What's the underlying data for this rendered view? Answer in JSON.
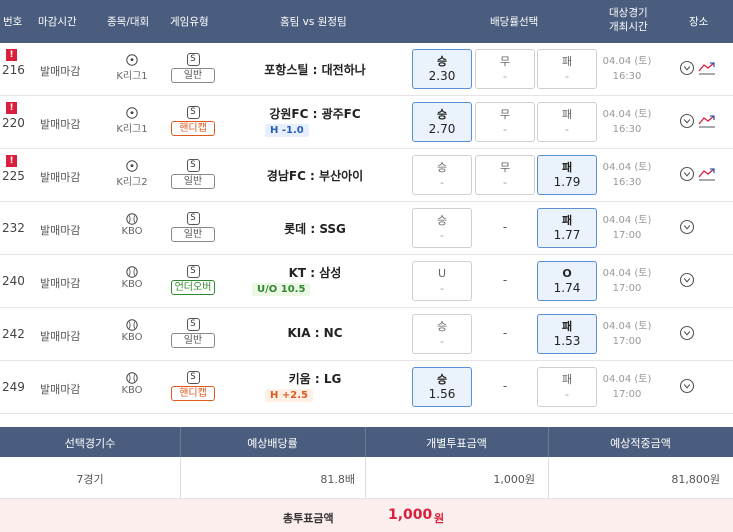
{
  "header": {
    "no": "번호",
    "close": "마감시간",
    "league": "종목/대회",
    "type": "게임유형",
    "match": "홈팀 vs 원정팀",
    "odds": "배당률선택",
    "time": "대상경기\n개최시간",
    "place": "장소"
  },
  "rows": [
    {
      "alert": "!",
      "no": "216",
      "close": "발매마감",
      "league": "K리그1",
      "sport": "soccer",
      "type_s": "S",
      "type": "일반",
      "match": "포항스틸 : 대전하나",
      "note": "",
      "win_label": "승",
      "win": "2.30",
      "draw_label": "무",
      "draw": "-",
      "lose_label": "패",
      "lose": "-",
      "date": "04.04 (토)",
      "time": "16:30"
    },
    {
      "alert": "!",
      "no": "220",
      "close": "발매마감",
      "league": "K리그1",
      "sport": "soccer",
      "type_s": "S",
      "type": "핸디캡",
      "match": "강원FC : 광주FC",
      "note": "H -1.0",
      "win_label": "승",
      "win": "2.70",
      "draw_label": "무",
      "draw": "-",
      "lose_label": "패",
      "lose": "-",
      "date": "04.04 (토)",
      "time": "16:30"
    },
    {
      "alert": "!",
      "no": "225",
      "close": "발매마감",
      "league": "K리그2",
      "sport": "soccer",
      "type_s": "S",
      "type": "일반",
      "match": "경남FC : 부산아이",
      "note": "",
      "win_label": "승",
      "win": "-",
      "draw_label": "무",
      "draw": "-",
      "lose_label": "패",
      "lose": "1.79",
      "date": "04.04 (토)",
      "time": "16:30"
    },
    {
      "alert": "",
      "no": "232",
      "close": "발매마감",
      "league": "KBO",
      "sport": "baseball",
      "type_s": "S",
      "type": "일반",
      "match": "롯데 : SSG",
      "note": "",
      "win_label": "승",
      "win": "-",
      "draw": "-",
      "lose_label": "패",
      "lose": "1.77",
      "date": "04.04 (토)",
      "time": "17:00"
    },
    {
      "alert": "",
      "no": "240",
      "close": "발매마감",
      "league": "KBO",
      "sport": "baseball",
      "type_s": "S",
      "type": "언더오버",
      "match": "KT : 삼성",
      "note": "U/O 10.5",
      "win_label": "U",
      "win": "-",
      "draw": "-",
      "lose_label": "O",
      "lose": "1.74",
      "date": "04.04 (토)",
      "time": "17:00"
    },
    {
      "alert": "",
      "no": "242",
      "close": "발매마감",
      "league": "KBO",
      "sport": "baseball",
      "type_s": "S",
      "type": "일반",
      "match": "KIA : NC",
      "note": "",
      "win_label": "승",
      "win": "-",
      "draw": "-",
      "lose_label": "패",
      "lose": "1.53",
      "date": "04.04 (토)",
      "time": "17:00"
    },
    {
      "alert": "",
      "no": "249",
      "close": "발매마감",
      "league": "KBO",
      "sport": "baseball",
      "type_s": "S",
      "type": "핸디캡",
      "match": "키움 : LG",
      "note": "H +2.5",
      "win_label": "승",
      "win": "1.56",
      "draw": "-",
      "lose_label": "패",
      "lose": "-",
      "date": "04.04 (토)",
      "time": "17:00"
    }
  ],
  "summary": {
    "h_count": "선택경기수",
    "h_odds": "예상배당률",
    "h_bet": "개별투표금액",
    "h_win": "예상적중금액",
    "count": "7경기",
    "odds": "81.8배",
    "bet": "1,000원",
    "win": "81,800원"
  },
  "total": {
    "label": "총투표금액",
    "amount": "1,000",
    "unit": "원"
  },
  "colors": {
    "header_bg": "#4a5d7e",
    "alert": "#d91f3c",
    "selected": "#eaf2fc",
    "total_bg": "#fdeeee",
    "amount": "#d91f3c"
  }
}
